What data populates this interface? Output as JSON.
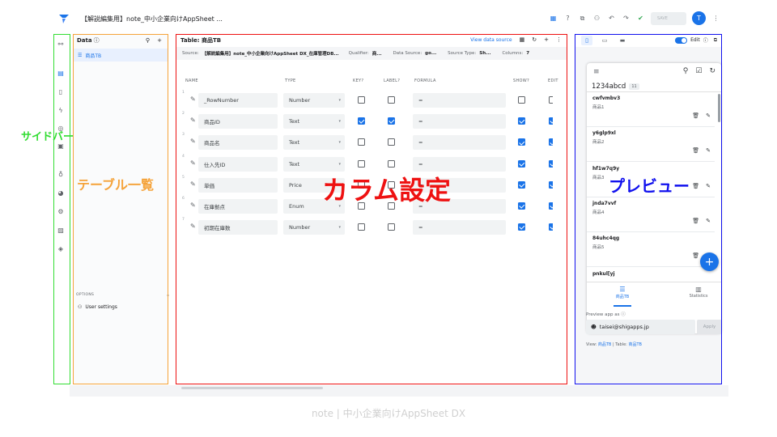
{
  "app": {
    "title": "【解説編集用】note_中小企業向けAppSheet ...",
    "save_label": "SAVE",
    "avatar_letter": "T"
  },
  "topbar_icons": [
    "table-icon",
    "help-icon",
    "copy-icon",
    "add-person-icon",
    "undo-icon",
    "redo-icon",
    "check-icon"
  ],
  "sidebar_icons": [
    "data-icon",
    "table-icon",
    "phone-icon",
    "automation-icon",
    "actions-icon",
    "views-icon",
    "idea-icon",
    "security-icon",
    "settings-icon",
    "image-icon",
    "manage-icon"
  ],
  "data_panel": {
    "title": "Data",
    "table_item": "商品TB",
    "options_label": "OPTIONS",
    "user_settings": "User settings"
  },
  "table_panel": {
    "title": "Table: 商品TB",
    "view_source": "View data source",
    "source_label": "Source:",
    "source_value": "【解説編集用】note_中小企業向けAppSheet DX_在庫管理DB...",
    "qualifier_label": "Qualifier:",
    "qualifier_value": "商...",
    "data_source_label": "Data Source:",
    "data_source_value": "go...",
    "source_type_label": "Source Type:",
    "source_type_value": "Sh...",
    "columns_label": "Columns:",
    "columns_value": "7",
    "headers": {
      "name": "NAME",
      "type": "TYPE",
      "key": "KEY?",
      "label": "LABEL?",
      "formula": "FORMULA",
      "show": "SHOW?",
      "edit": "EDIT"
    },
    "rows": [
      {
        "num": "1",
        "name": "_RowNumber",
        "type": "Number",
        "key": false,
        "label": false,
        "formula": "=",
        "show": false,
        "edit": false
      },
      {
        "num": "2",
        "name": "商品ID",
        "type": "Text",
        "key": true,
        "label": true,
        "formula": "=",
        "show": true,
        "edit": true
      },
      {
        "num": "3",
        "name": "商品名",
        "type": "Text",
        "key": false,
        "label": false,
        "formula": "=",
        "show": true,
        "edit": true
      },
      {
        "num": "4",
        "name": "仕入先ID",
        "type": "Text",
        "key": false,
        "label": false,
        "formula": "=",
        "show": true,
        "edit": true
      },
      {
        "num": "5",
        "name": "単価",
        "type": "Price",
        "key": false,
        "label": false,
        "formula": "=",
        "show": true,
        "edit": true
      },
      {
        "num": "6",
        "name": "在庫拠点",
        "type": "Enum",
        "key": false,
        "label": false,
        "formula": "=",
        "show": true,
        "edit": true
      },
      {
        "num": "7",
        "name": "初期在庫数",
        "type": "Number",
        "key": false,
        "label": false,
        "formula": "=",
        "show": true,
        "edit": true
      }
    ]
  },
  "preview": {
    "edit_label": "Edit",
    "group_title": "1234abcd",
    "group_count": "11",
    "items": [
      {
        "id": "cwfvmbv3",
        "name": "商品1"
      },
      {
        "id": "y6glp9xl",
        "name": "商品2"
      },
      {
        "id": "hf1w7q9y",
        "name": "商品3"
      },
      {
        "id": "jnda7vvf",
        "name": "商品4"
      },
      {
        "id": "84uhc4qg",
        "name": "商品5"
      },
      {
        "id": "pnkul[yj",
        "name": ""
      }
    ],
    "nav_tabs": [
      {
        "label": "商品TB",
        "active": true
      },
      {
        "label": "Statistics",
        "active": false
      }
    ],
    "preview_as_label": "Preview app as",
    "user_email": "taisei@shigapps.jp",
    "apply_label": "Apply",
    "view_label": "View:",
    "view_value": "商品TB",
    "table_label": "Table:",
    "table_value": "商品TB"
  },
  "annotations": {
    "sidebar": {
      "text": "サイドバー",
      "color": "#33dd33"
    },
    "table_list": {
      "text": "テーブル一覧",
      "color": "#f5a33a"
    },
    "column_settings": {
      "text": "カラム設定",
      "color": "#ee1111"
    },
    "preview": {
      "text": "プレビュー",
      "color": "#1111ee"
    }
  },
  "footer": "note | 中小企業向けAppSheet DX",
  "colors": {
    "accent": "#1a73e8",
    "logo": "#1a73e8"
  }
}
